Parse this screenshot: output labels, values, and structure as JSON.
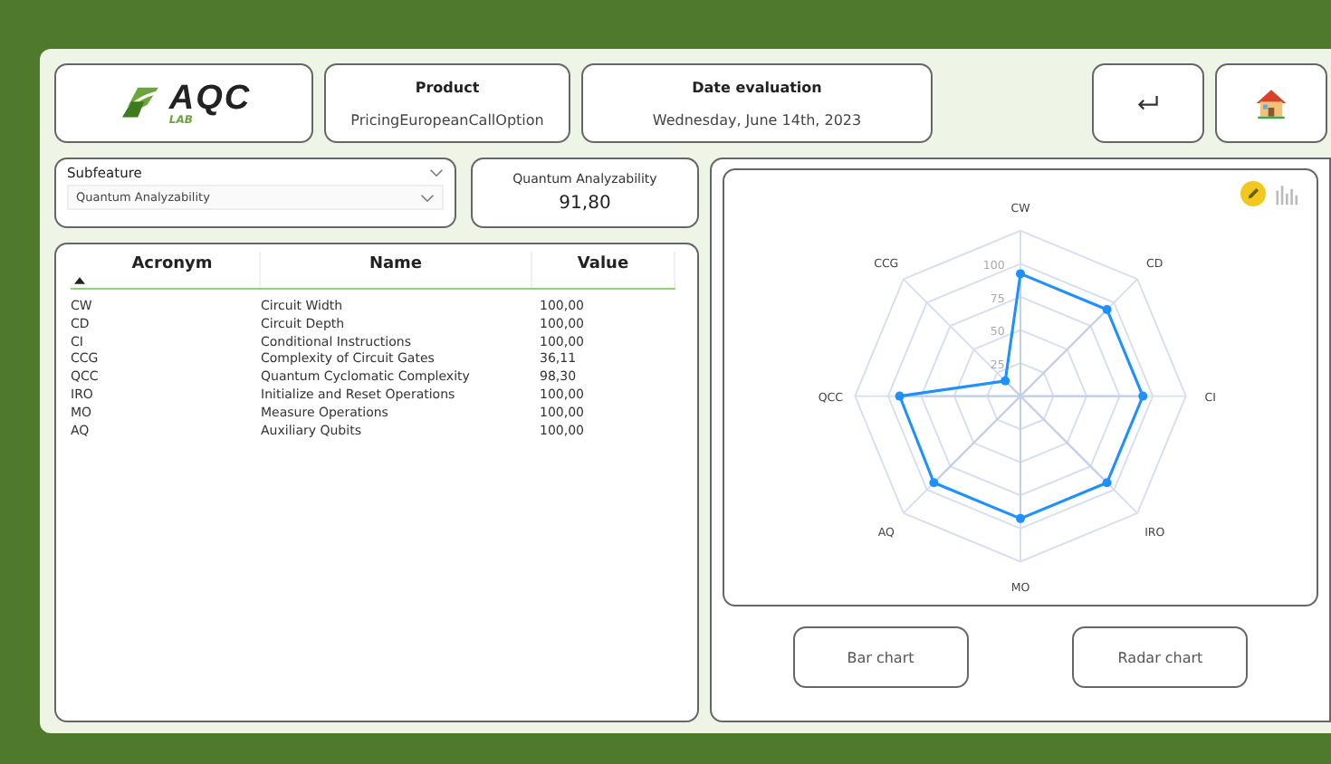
{
  "header": {
    "logo": {
      "text": "AQC",
      "subtext": "LAB"
    },
    "product": {
      "label": "Product",
      "value": "PricingEuropeanCallOption"
    },
    "date": {
      "label": "Date evaluation",
      "value": "Wednesday, June 14th, 2023"
    }
  },
  "subfeature": {
    "label": "Subfeature",
    "value": "Quantum Analyzability"
  },
  "score": {
    "label": "Quantum Analyzability",
    "value": "91,80"
  },
  "table": {
    "columns": [
      {
        "label": "Acronym",
        "sorted": true
      },
      {
        "label": "Name",
        "sorted": false
      },
      {
        "label": "Value",
        "sorted": false
      }
    ],
    "rows": [
      [
        "CW",
        "Circuit Width",
        "100,00"
      ],
      [
        "CD",
        "Circuit Depth",
        "100,00"
      ],
      [
        "CI",
        "Conditional Instructions",
        "100,00"
      ],
      [
        "CCG",
        "Complexity of Circuit Gates",
        "36,11"
      ],
      [
        "QCC",
        "Quantum Cyclomatic Complexity",
        "98,30"
      ],
      [
        "IRO",
        "Initialize and Reset Operations",
        "100,00"
      ],
      [
        "MO",
        "Measure Operations",
        "100,00"
      ],
      [
        "AQ",
        "Auxiliary Qubits",
        "100,00"
      ]
    ]
  },
  "chart": {
    "ticks": [
      "100",
      "75",
      "50",
      "25"
    ],
    "axes": [
      {
        "label": "CW",
        "level": 0.74
      },
      {
        "label": "CD",
        "level": 0.74
      },
      {
        "label": "CI",
        "level": 0.74
      },
      {
        "label": "IRO",
        "level": 0.74
      },
      {
        "label": "MO",
        "level": 0.74
      },
      {
        "label": "AQ",
        "level": 0.74
      },
      {
        "label": "QCC",
        "level": 0.73
      },
      {
        "label": "CCG",
        "level": 0.13
      }
    ]
  },
  "buttons": [
    "Bar chart",
    "Radar chart"
  ]
}
